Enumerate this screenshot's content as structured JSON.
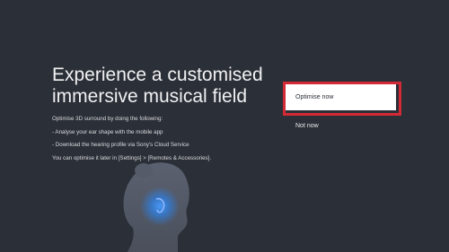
{
  "screen": {
    "title_line1": "Experience a customised",
    "title_line2": "immersive musical field",
    "description": [
      "Optimise 3D surround by doing the following:",
      "- Analyse your ear shape with the mobile app",
      "- Download the hearing profile via Sony's Cloud Service",
      "You can optimise it later in [Settings] > [Remotes & Accessories]."
    ]
  },
  "actions": {
    "optimise_now": "Optimise now",
    "not_now": "Not now"
  },
  "colors": {
    "background": "#2b2f37",
    "highlight": "#d32a36",
    "sound_glow": "#2f7fe0"
  },
  "icons": {
    "illustration": "head-with-ear-sound-icon"
  }
}
